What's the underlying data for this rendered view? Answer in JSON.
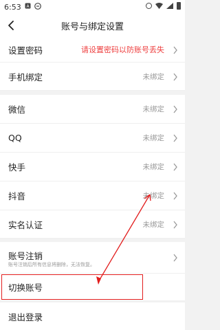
{
  "status_bar": {
    "time": "6:53",
    "icons": [
      "notification-a-icon",
      "notification-e-icon"
    ],
    "right_icons": [
      "alarm-icon",
      "wifi-icon",
      "signal-icon",
      "battery-icon"
    ]
  },
  "nav": {
    "title": "账号与绑定设置",
    "back_icon": "chevron-left-icon"
  },
  "rows": [
    {
      "label": "设置密码",
      "value": "请设置密码以防账号丢失",
      "value_color": "#ee4040"
    },
    {
      "label": "手机绑定",
      "value": "未绑定"
    },
    {
      "label": "微信",
      "value": "未绑定"
    },
    {
      "label": "QQ",
      "value": "未绑定"
    },
    {
      "label": "快手",
      "value": "未绑定"
    },
    {
      "label": "抖音",
      "value": "未绑定"
    },
    {
      "label": "实名认证",
      "value": "未绑定"
    },
    {
      "label": "账号注销",
      "sub": "账号注销后所有信息将删除，无法恢复。",
      "value": ""
    },
    {
      "label": "切换账号",
      "value": ""
    },
    {
      "label": "退出登录",
      "value": ""
    }
  ],
  "annotation": {
    "highlight_color": "#e21c1c",
    "arrow_color": "#e21c1c"
  }
}
